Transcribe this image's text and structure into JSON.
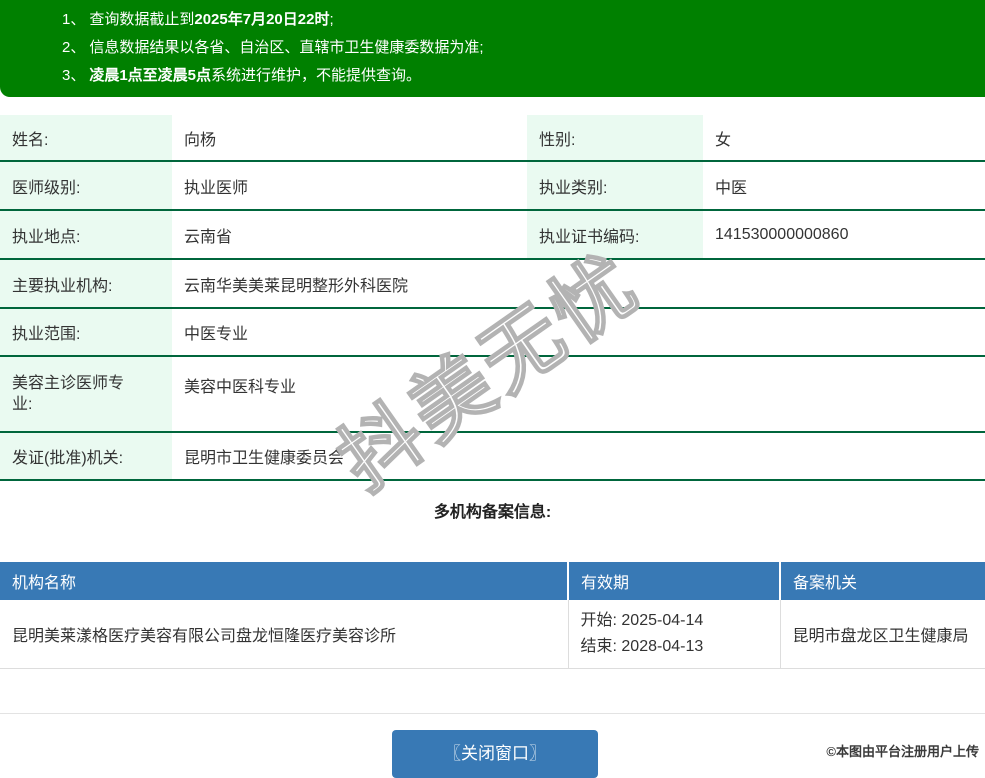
{
  "notices": {
    "items": [
      {
        "num": "1、",
        "pre": "查询数据截止到",
        "bold": "2025年7月20日22时",
        "post": ";"
      },
      {
        "num": "2、",
        "pre": "信息数据结果以各省、自治区、直辖市卫生健康委数据为准;",
        "bold": "",
        "post": ""
      },
      {
        "num": "3、",
        "pre": "",
        "bold": "凌晨1点至凌晨5点",
        "post": "系统进行维护，不能提供查询。"
      }
    ]
  },
  "profile": {
    "name_label": "姓名:",
    "name_value": "向杨",
    "gender_label": "性别:",
    "gender_value": "女",
    "doctor_level_label": "医师级别:",
    "doctor_level_value": "执业医师",
    "practice_category_label": "执业类别:",
    "practice_category_value": "中医",
    "practice_location_label": "执业地点:",
    "practice_location_value": "云南省",
    "certificate_no_label": "执业证书编码:",
    "certificate_no_value": "141530000000860",
    "primary_org_label": "主要执业机构:",
    "primary_org_value": "云南华美美莱昆明整形外科医院",
    "practice_scope_label": "执业范围:",
    "practice_scope_value": "中医专业",
    "cosmetic_specialty_label": "美容主诊医师专业:",
    "cosmetic_specialty_value": "美容中医科专业",
    "issuing_authority_label": "发证(批准)机关:",
    "issuing_authority_value": "昆明市卫生健康委员会"
  },
  "multi_org": {
    "title": "多机构备案信息:",
    "headers": {
      "org_name": "机构名称",
      "validity": "有效期",
      "filing_authority": "备案机关"
    },
    "record": {
      "org_name": "昆明美莱漾格医疗美容有限公司盘龙恒隆医疗美容诊所",
      "validity_start": "开始: 2025-04-14",
      "validity_end": "结束: 2028-04-13",
      "filing_authority": "昆明市盘龙区卫生健康局"
    }
  },
  "watermark": {
    "text": "抖美无忧"
  },
  "footer": {
    "close_button": "〖关闭窗口〗",
    "upload_note": "©本图由平台注册用户上传"
  },
  "colors": {
    "notice_green": "#008000",
    "label_cell_green": "#eafaf1",
    "divider_green": "#00663c",
    "table_header_blue": "#3879b5"
  }
}
